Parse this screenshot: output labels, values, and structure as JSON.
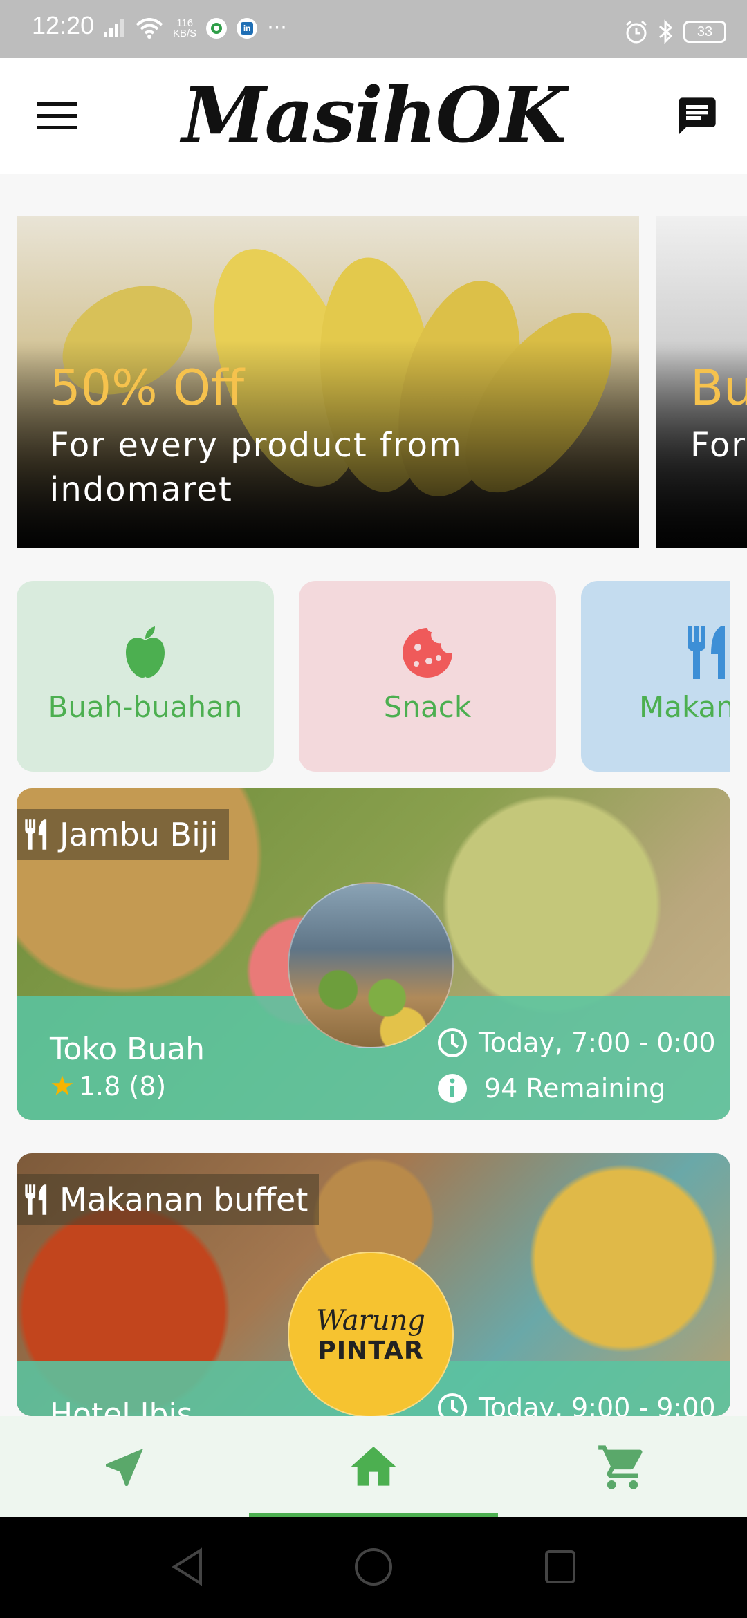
{
  "status_bar": {
    "time": "12:20",
    "speed_value": "116",
    "speed_unit": "KB/S",
    "battery": "33",
    "icons": [
      "signal-icon",
      "wifi-icon",
      "app-notification-icon",
      "linkedin-icon",
      "more-icon",
      "alarm-icon",
      "bluetooth-icon",
      "battery-icon"
    ]
  },
  "app_bar": {
    "title": "MasihOK",
    "menu_icon": "hamburger-menu-icon",
    "chat_icon": "chat-icon"
  },
  "banners": [
    {
      "title": "50% Off",
      "subtitle": "For every product from indomaret"
    },
    {
      "title": "Bu",
      "subtitle": "For Bua"
    }
  ],
  "categories": [
    {
      "label": "Buah-buahan",
      "icon": "apple-icon",
      "bg": "#d9ebdd",
      "icon_color": "#4caf50"
    },
    {
      "label": "Snack",
      "icon": "cookie-icon",
      "bg": "#f3d9dc",
      "icon_color": "#ef5a5a"
    },
    {
      "label": "Makan B",
      "icon": "utensils-icon",
      "bg": "#c4dcef",
      "icon_color": "#3d8fd6"
    }
  ],
  "stores": [
    {
      "tag": "Jambu Biji",
      "name": "Toko Buah",
      "rating": "1.8 (8)",
      "hours": "Today,  7:00 - 0:00",
      "remaining": "94 Remaining"
    },
    {
      "tag": "Makanan buffet",
      "name": "Hotel Ibis",
      "logo_line1": "Warung",
      "logo_line2": "PINTAR",
      "hours": "Today,  9:00 - 9:00"
    }
  ],
  "bottom_nav": {
    "items": [
      "navigation-icon",
      "home-icon",
      "cart-icon"
    ],
    "active": "home-icon",
    "active_color": "#4caf50",
    "inactive_color": "#5aa86a"
  }
}
